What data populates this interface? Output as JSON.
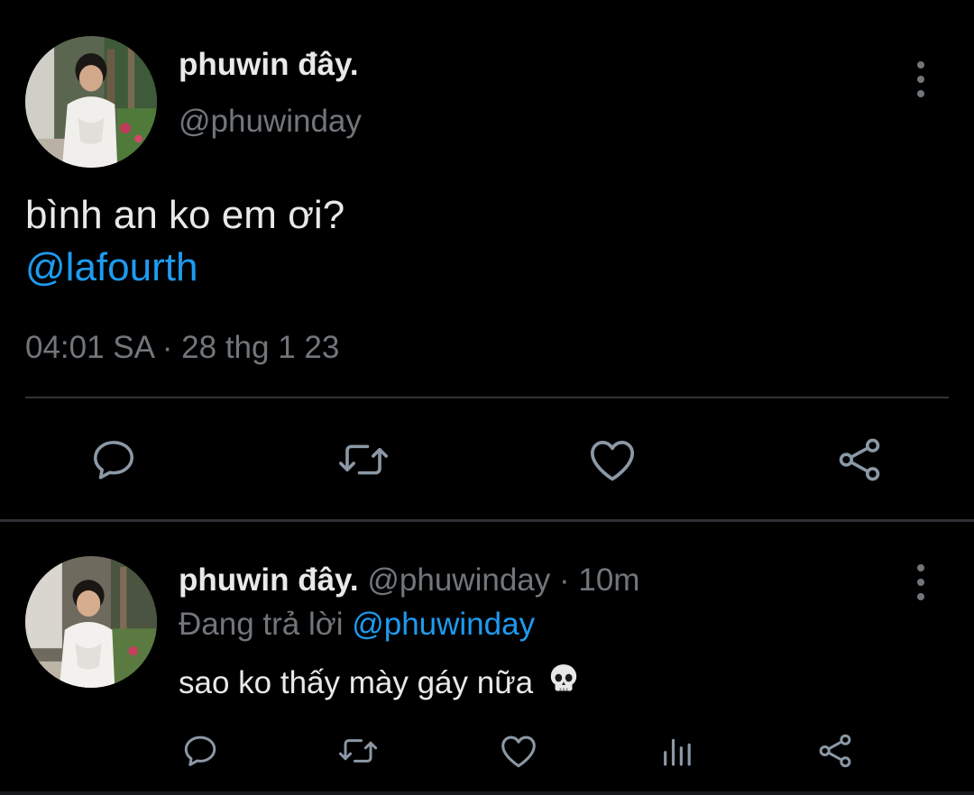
{
  "main_tweet": {
    "display_name": "phuwin đây.",
    "handle": "@phuwinday",
    "text": "bình an ko em ơi?",
    "mention": "@lafourth",
    "meta": "04:01 SA · 28 thg 1 23",
    "actions": [
      "reply-icon",
      "retweet-icon",
      "like-icon",
      "share-icon"
    ]
  },
  "reply_tweet": {
    "display_name": "phuwin đây.",
    "handle_time": "@phuwinday · 10m",
    "replying_prefix": "Đang trả lời",
    "replying_to": "@phuwinday",
    "text": "sao ko thấy mày gáy nữa",
    "emoji": "skull-emoji",
    "actions": [
      "reply-icon",
      "retweet-icon",
      "like-icon",
      "analytics-icon",
      "share-icon"
    ]
  },
  "colors": {
    "background": "#000000",
    "text_primary": "#e7e9ea",
    "text_secondary": "#71767b",
    "accent": "#1d9bf0",
    "divider": "#2f3336"
  }
}
